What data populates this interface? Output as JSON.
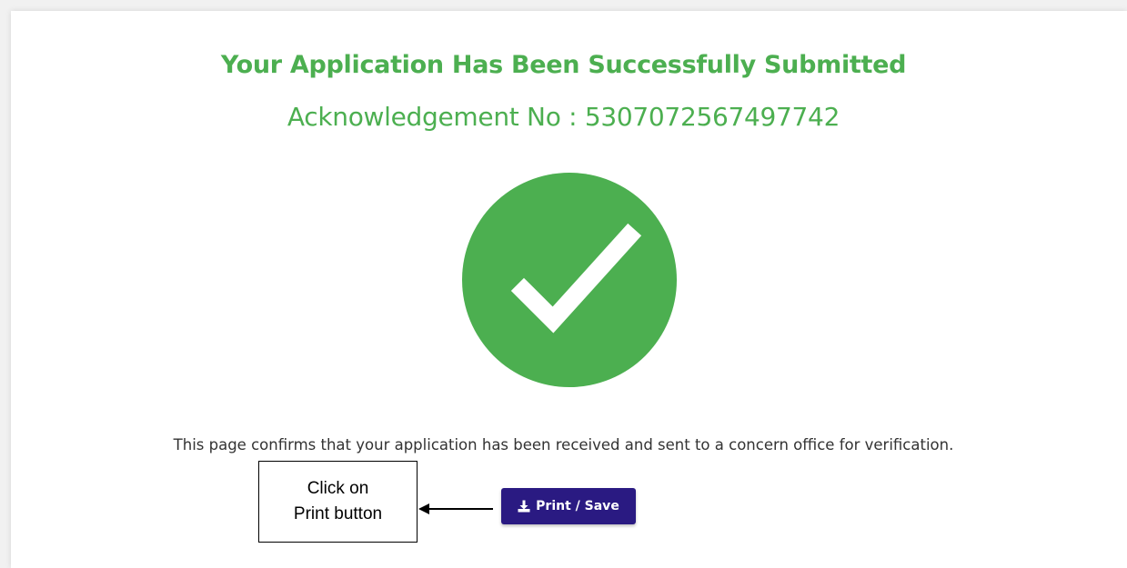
{
  "header": {
    "title": "Your Application Has Been Successfully Submitted",
    "acknowledgement": "Acknowledgement No : 5307072567497742"
  },
  "status_icon": "check-circle-icon",
  "message": "This page confirms that your application has been received and sent to a concern office for verification.",
  "print_button": {
    "label": "Print / Save",
    "icon": "download-icon"
  },
  "callout": {
    "line1": "Click on",
    "line2": "Print button"
  },
  "colors": {
    "success": "#4caf50",
    "button": "#2a1a82"
  }
}
